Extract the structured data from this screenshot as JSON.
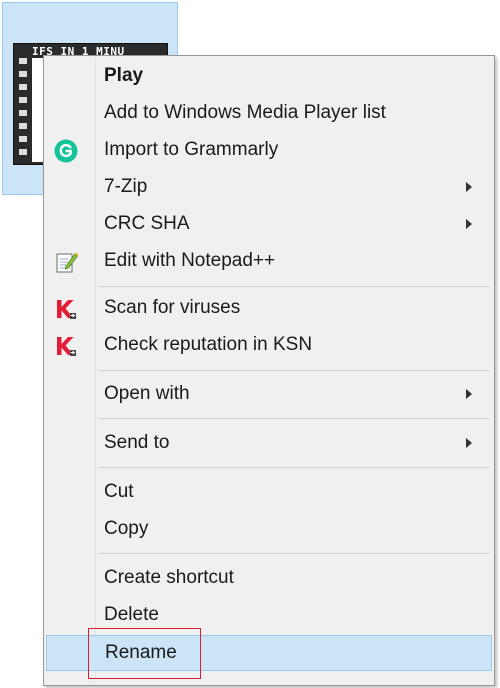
{
  "file": {
    "thumbnail_text": "IFS IN 1 MINU"
  },
  "context_menu": {
    "items": [
      {
        "label": "Play",
        "icon": "",
        "submenu": false
      },
      {
        "label": "Add to Windows Media Player list",
        "icon": "",
        "submenu": false
      },
      {
        "label": "Import to Grammarly",
        "icon": "grammarly-icon",
        "submenu": false
      },
      {
        "label": "7-Zip",
        "icon": "",
        "submenu": true
      },
      {
        "label": "CRC SHA",
        "icon": "",
        "submenu": true
      },
      {
        "label": "Edit with Notepad++",
        "icon": "notepad-plus-plus-icon",
        "submenu": false
      },
      {
        "label": "Scan for viruses",
        "icon": "kaspersky-icon",
        "submenu": false
      },
      {
        "label": "Check reputation in KSN",
        "icon": "kaspersky-icon",
        "submenu": false
      },
      {
        "label": "Open with",
        "icon": "",
        "submenu": true
      },
      {
        "label": "Send to",
        "icon": "",
        "submenu": true
      },
      {
        "label": "Cut",
        "icon": "",
        "submenu": false
      },
      {
        "label": "Copy",
        "icon": "",
        "submenu": false
      },
      {
        "label": "Create shortcut",
        "icon": "",
        "submenu": false
      },
      {
        "label": "Delete",
        "icon": "",
        "submenu": false
      },
      {
        "label": "Rename",
        "icon": "",
        "submenu": false,
        "highlighted": true
      }
    ]
  },
  "colors": {
    "menu_background": "#f0f0f0",
    "highlight": "#cce4f7",
    "highlight_border": "#99c9ef",
    "annotation_red": "#d21f2e",
    "grammarly_green": "#15c39a",
    "kaspersky_red": "#e31d38"
  }
}
